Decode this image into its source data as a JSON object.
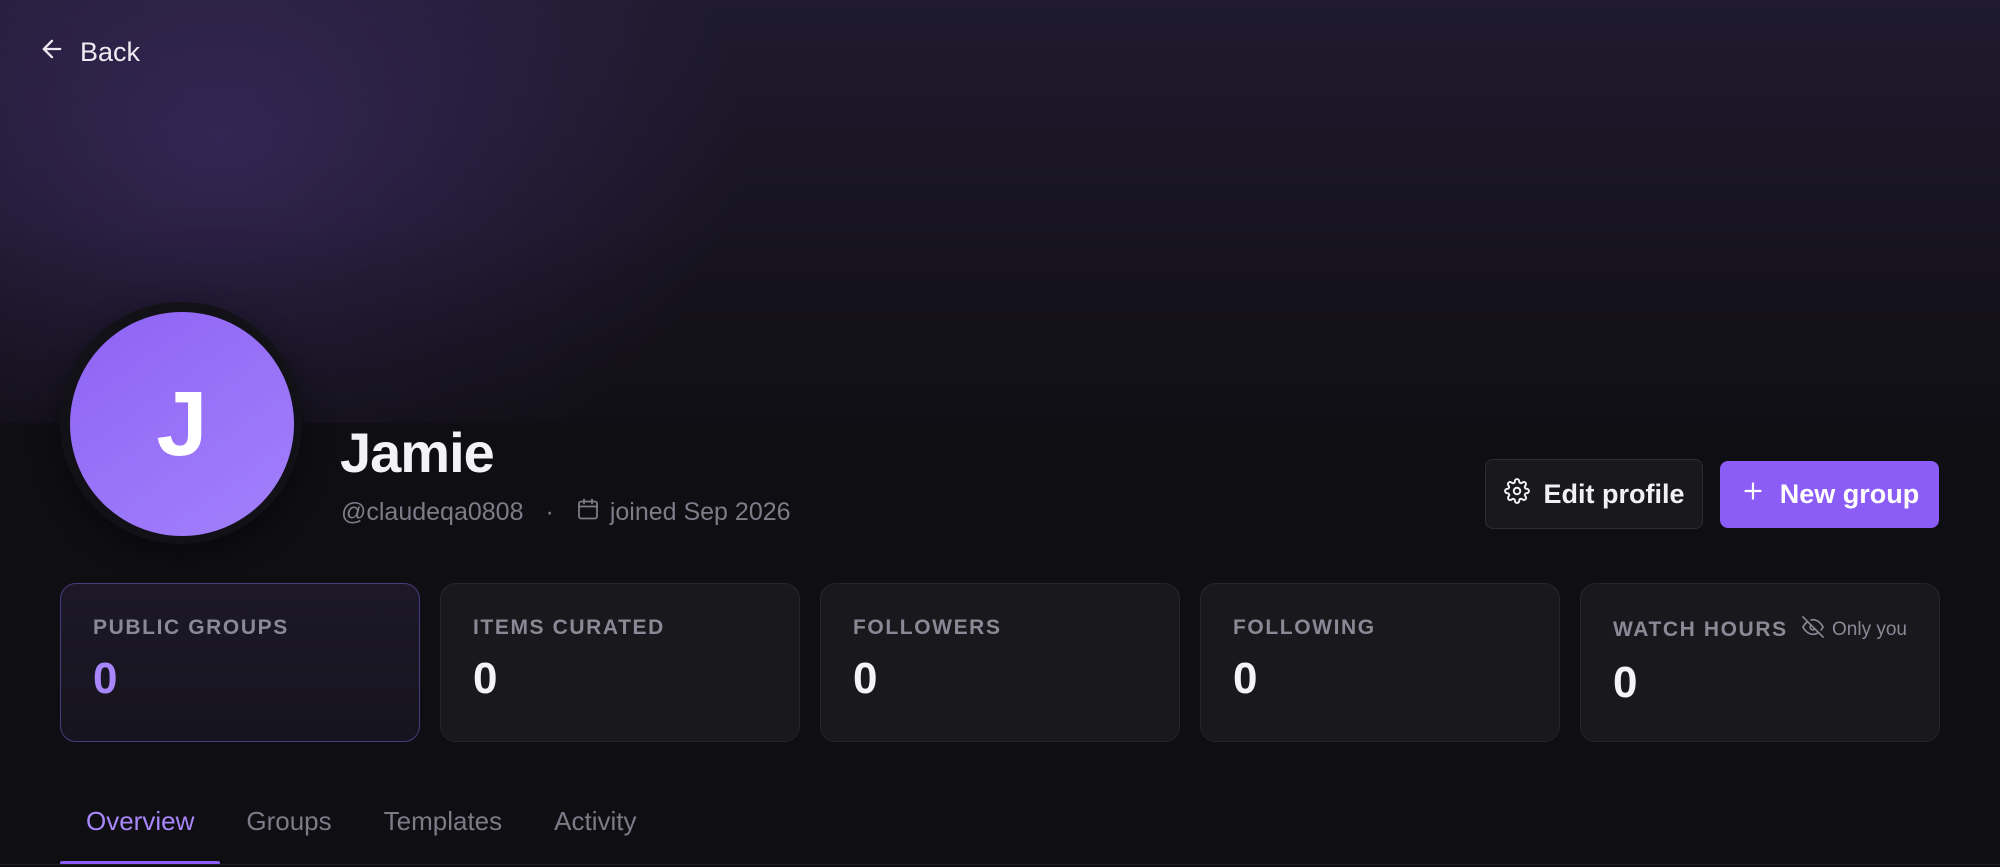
{
  "nav": {
    "back_label": "Back"
  },
  "profile": {
    "initial": "J",
    "name": "Jamie",
    "handle": "@claudeqa0808",
    "separator": "·",
    "joined": "joined Sep 2026"
  },
  "actions": {
    "edit_label": "Edit profile",
    "new_group_label": "New group"
  },
  "stats": [
    {
      "label": "PUBLIC GROUPS",
      "value": "0"
    },
    {
      "label": "ITEMS CURATED",
      "value": "0"
    },
    {
      "label": "FOLLOWERS",
      "value": "0"
    },
    {
      "label": "FOLLOWING",
      "value": "0"
    },
    {
      "label": "WATCH HOURS",
      "value": "0",
      "visibility": "Only you"
    }
  ],
  "tabs": [
    {
      "label": "Overview",
      "active": true
    },
    {
      "label": "Groups",
      "active": false
    },
    {
      "label": "Templates",
      "active": false
    },
    {
      "label": "Activity",
      "active": false
    }
  ],
  "colors": {
    "accent": "#8b5cf6",
    "accent_text": "#a886fb",
    "background": "#0f0e13",
    "card": "#18181d"
  },
  "icons": {
    "back": "arrow-left-icon",
    "calendar": "calendar-icon",
    "settings": "gear-icon",
    "add": "plus-icon",
    "private": "eye-off-icon"
  }
}
